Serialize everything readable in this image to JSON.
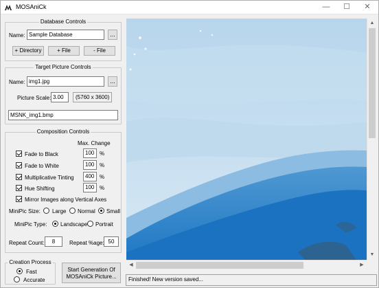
{
  "window": {
    "title": "MOSAniCk",
    "minimize": "—",
    "maximize": "☐",
    "close": "✕"
  },
  "database": {
    "group_title": "Database Controls",
    "name_label": "Name:",
    "name_value": "Sample Database",
    "browse": "...",
    "add_directory": "+ Directory",
    "add_file": "+ File",
    "remove_file": "- File"
  },
  "target": {
    "group_title": "Target Picture Controls",
    "name_label": "Name:",
    "name_value": "img1.jpg",
    "browse": "...",
    "scale_label": "Picture Scale:",
    "scale_value": "3.00",
    "dimensions": "(5760 x 3600)",
    "output_name": "MSNK_img1.bmp"
  },
  "composition": {
    "group_title": "Composition Controls",
    "max_change_label": "Max. Change",
    "options": [
      {
        "label": "Fade to Black",
        "value": "100",
        "unit": "%"
      },
      {
        "label": "Fade to White",
        "value": "100",
        "unit": "%"
      },
      {
        "label": "Multiplicative Tinting",
        "value": "400",
        "unit": "%"
      },
      {
        "label": "Hue Shifting",
        "value": "100",
        "unit": "%"
      }
    ],
    "mirror_label": "Mirror Images along Vertical Axes",
    "minipic_size_label": "MiniPic Size:",
    "size_large": "Large",
    "size_normal": "Normal",
    "size_small": "Small",
    "minipic_type_label": "MiniPic Type:",
    "type_landscape": "Landscape",
    "type_portrait": "Portrait",
    "repeat_count_label": "Repeat Count:",
    "repeat_count_value": "8",
    "repeat_pct_label": "Repeat %age:",
    "repeat_pct_value": "50"
  },
  "creation": {
    "group_title": "Creation Process",
    "fast": "Fast",
    "accurate": "Accurate",
    "start_line1": "Start Generation Of",
    "start_line2": "MOSAniCk Picture..."
  },
  "status_text": "Finished! New version saved...",
  "scrollbars": {
    "up": "▲",
    "down": "▼",
    "left": "◀",
    "right": "▶",
    "vertical_fraction": 0.14,
    "horizontal_fraction": 0.0
  }
}
